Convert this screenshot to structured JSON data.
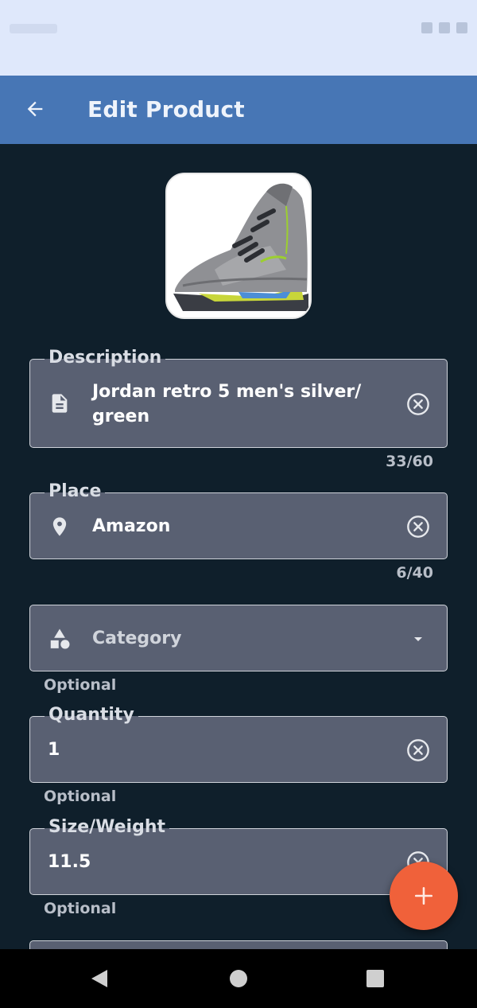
{
  "app_bar": {
    "title": "Edit Product",
    "back_icon": "arrow-left-icon",
    "background": "#4776b5"
  },
  "product": {
    "image_alt": "Jordan retro 5 sneaker photo"
  },
  "fields": {
    "description": {
      "label": "Description",
      "value": "Jordan retro 5 men's silver/ green",
      "counter": "33/60",
      "icon": "document-icon"
    },
    "place": {
      "label": "Place",
      "value": "Amazon",
      "counter": "6/40",
      "icon": "location-pin-icon"
    },
    "category": {
      "placeholder": "Category",
      "helper": "Optional",
      "icon": "shapes-icon"
    },
    "quantity": {
      "label": "Quantity",
      "value": "1",
      "helper": "Optional"
    },
    "size_weight": {
      "label": "Size/Weight",
      "value": "11.5",
      "helper": "Optional"
    }
  },
  "fab": {
    "icon": "plus-icon",
    "color": "#f0613a"
  },
  "colors": {
    "background": "#0f1f2b",
    "field_fill": "#596072",
    "accent": "#4776b5"
  }
}
